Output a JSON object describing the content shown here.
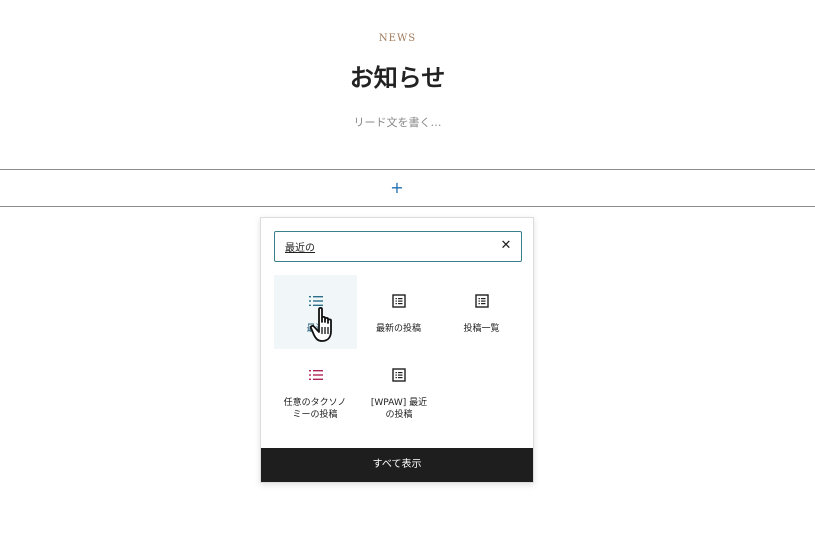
{
  "section": {
    "eyebrow": "NEWS",
    "title": "お知らせ",
    "lead": "リード文を書く…"
  },
  "appender": {
    "symbol": "+"
  },
  "inserter": {
    "search": {
      "value": "最近の",
      "clear_symbol": "✕"
    },
    "blocks": [
      {
        "label": "最近",
        "icon": "list-icon",
        "selected": true
      },
      {
        "label": "最新の投稿",
        "icon": "post-list-icon"
      },
      {
        "label": "投稿一覧",
        "icon": "post-list-icon"
      },
      {
        "label": "任意のタクソノミーの投稿",
        "icon": "list-icon"
      },
      {
        "label": "[WPAW] 最近の投稿",
        "icon": "post-list-icon"
      }
    ],
    "browse_all_label": "すべて表示"
  },
  "colors": {
    "accent": "#2271b1",
    "selected_bg": "#f1f7f9",
    "taxonomy_icon": "#b0245a"
  }
}
